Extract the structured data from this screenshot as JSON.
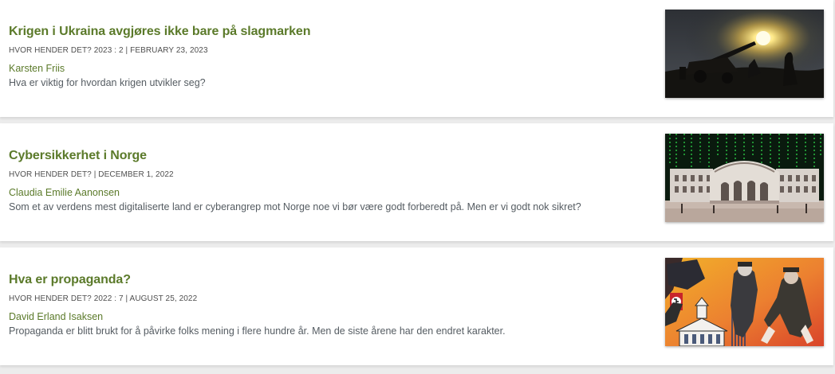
{
  "articles": [
    {
      "title": "Krigen i Ukraina avgjøres ikke bare på slagmarken",
      "meta": "HVOR HENDER DET? 2023 : 2 | FEBRUARY 23, 2023",
      "author": "Karsten Friis",
      "description": "Hva er viktig for hvordan krigen utvikler seg?",
      "image_icon": "artillery-firing-photo"
    },
    {
      "title": "Cybersikkerhet i Norge",
      "meta": "HVOR HENDER DET? | DECEMBER 1, 2022",
      "author": "Claudia Emilie Aanonsen",
      "description": "Som et av verdens mest digitaliserte land er cyberangrep mot Norge noe vi bør være godt forberedt på. Men er vi godt nok sikret?",
      "image_icon": "storting-matrix-photo"
    },
    {
      "title": "Hva er propaganda?",
      "meta": "HVOR HENDER DET? 2022 : 7 | AUGUST 25, 2022",
      "author": "David Erland Isaksen",
      "description": "Propaganda er blitt brukt for å påvirke folks mening i flere hundre år. Men de siste årene har den endret karakter.",
      "image_icon": "propaganda-poster-illustration"
    }
  ],
  "colors": {
    "title_green": "#5b7a2a",
    "body_text": "#555c62",
    "page_background": "#ececec"
  }
}
